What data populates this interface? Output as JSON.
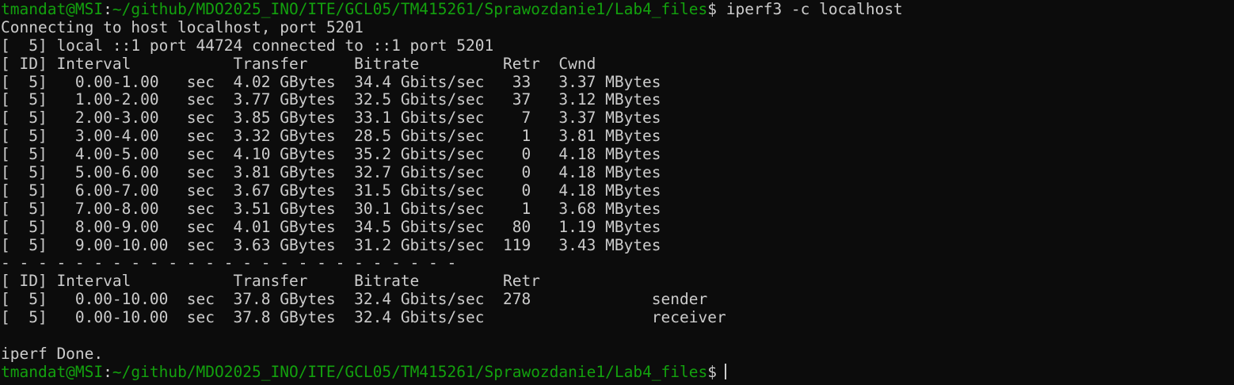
{
  "prompt": {
    "user_host": "tmandat@MSI",
    "colon": ":",
    "path": "~/github/MDO2025_INO/ITE/GCL05/TM415261/Sprawozdanie1/Lab4_files",
    "dollar": "$",
    "command": " iperf3 -c localhost"
  },
  "output": {
    "connecting": "Connecting to host localhost, port 5201",
    "local": "[  5] local ::1 port 44724 connected to ::1 port 5201",
    "header1": "[ ID] Interval           Transfer     Bitrate         Retr  Cwnd",
    "rows": [
      "[  5]   0.00-1.00   sec  4.02 GBytes  34.4 Gbits/sec   33   3.37 MBytes",
      "[  5]   1.00-2.00   sec  3.77 GBytes  32.5 Gbits/sec   37   3.12 MBytes",
      "[  5]   2.00-3.00   sec  3.85 GBytes  33.1 Gbits/sec    7   3.37 MBytes",
      "[  5]   3.00-4.00   sec  3.32 GBytes  28.5 Gbits/sec    1   3.81 MBytes",
      "[  5]   4.00-5.00   sec  4.10 GBytes  35.2 Gbits/sec    0   4.18 MBytes",
      "[  5]   5.00-6.00   sec  3.81 GBytes  32.7 Gbits/sec    0   4.18 MBytes",
      "[  5]   6.00-7.00   sec  3.67 GBytes  31.5 Gbits/sec    0   4.18 MBytes",
      "[  5]   7.00-8.00   sec  3.51 GBytes  30.1 Gbits/sec    1   3.68 MBytes",
      "[  5]   8.00-9.00   sec  4.01 GBytes  34.5 Gbits/sec   80   1.19 MBytes",
      "[  5]   9.00-10.00  sec  3.63 GBytes  31.2 Gbits/sec  119   3.43 MBytes"
    ],
    "separator": "- - - - - - - - - - - - - - - - - - - - - - - - -",
    "header2": "[ ID] Interval           Transfer     Bitrate         Retr",
    "summary_sender": "[  5]   0.00-10.00  sec  37.8 GBytes  32.4 Gbits/sec  278             sender",
    "summary_receiver": "[  5]   0.00-10.00  sec  37.8 GBytes  32.4 Gbits/sec                  receiver",
    "blank": "",
    "done": "iperf Done."
  },
  "colors": {
    "background": "#0c0c0c",
    "foreground": "#cccccc",
    "prompt_green": "#13a10e"
  }
}
